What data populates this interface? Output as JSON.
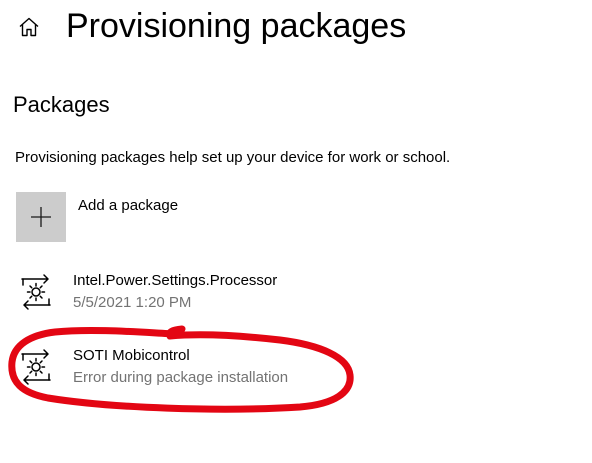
{
  "header": {
    "home_icon": "home-icon",
    "title": "Provisioning packages"
  },
  "packages_section": {
    "heading": "Packages",
    "description": "Provisioning packages help set up your device for work or school.",
    "add_package": {
      "icon": "plus-icon",
      "label": "Add a package"
    },
    "items": [
      {
        "icon": "package-gear-icon",
        "name": "Intel.Power.Settings.Processor",
        "detail": "5/5/2021 1:20 PM"
      },
      {
        "icon": "package-gear-icon",
        "name": "SOTI Mobicontrol",
        "detail": "Error during package installation"
      }
    ]
  },
  "annotation": {
    "type": "hand-drawn circle",
    "color": "#e30613"
  },
  "colors": {
    "background": "#ffffff",
    "text": "#000000",
    "secondary_text": "#737373",
    "add_tile": "#cccccc",
    "annotation": "#e30613"
  }
}
